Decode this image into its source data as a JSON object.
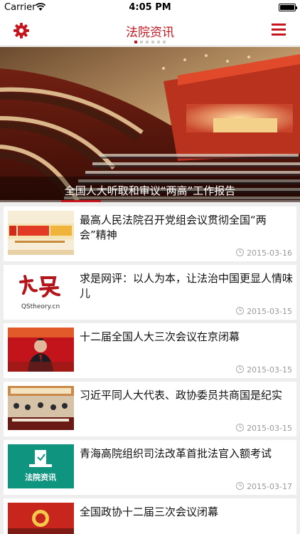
{
  "status_bar": {
    "carrier": "Carrier",
    "time": "4:05 PM"
  },
  "nav": {
    "title": "法院资讯",
    "page_count": 6,
    "active_page": 1
  },
  "hero": {
    "caption": "全国人大听取和审议“两高”工作报告",
    "image": "great-hall-session-photo"
  },
  "news": [
    {
      "title": "最高人民法院召开党组会议贯彻全国“两会”精神",
      "date": "2015-03-16",
      "thumb": "court-banner-thumb"
    },
    {
      "title": "求是网评：以人为本，让法治中国更显人情味儿",
      "date": "2015-03-15",
      "thumb": "qstheory-logo-thumb",
      "thumb_text": "QStheory.cn"
    },
    {
      "title": "十二届全国人大三次会议在京闭幕",
      "date": "2015-03-15",
      "thumb": "speaker-photo-thumb"
    },
    {
      "title": "习近平同人大代表、政协委员共商国是纪实",
      "date": "2015-03-15",
      "thumb": "meeting-photo-thumb"
    },
    {
      "title": "青海高院组织司法改革首批法官入额考试",
      "date": "2015-03-17",
      "thumb": "court-news-logo-thumb",
      "thumb_text": "法院资讯"
    },
    {
      "title": "全国政协十二届三次会议闭幕",
      "date": "",
      "thumb": "cppcc-photo-thumb"
    }
  ],
  "colors": {
    "accent": "#c7161d",
    "background": "#eeeeee",
    "card": "#ffffff",
    "date_text": "#999999"
  }
}
